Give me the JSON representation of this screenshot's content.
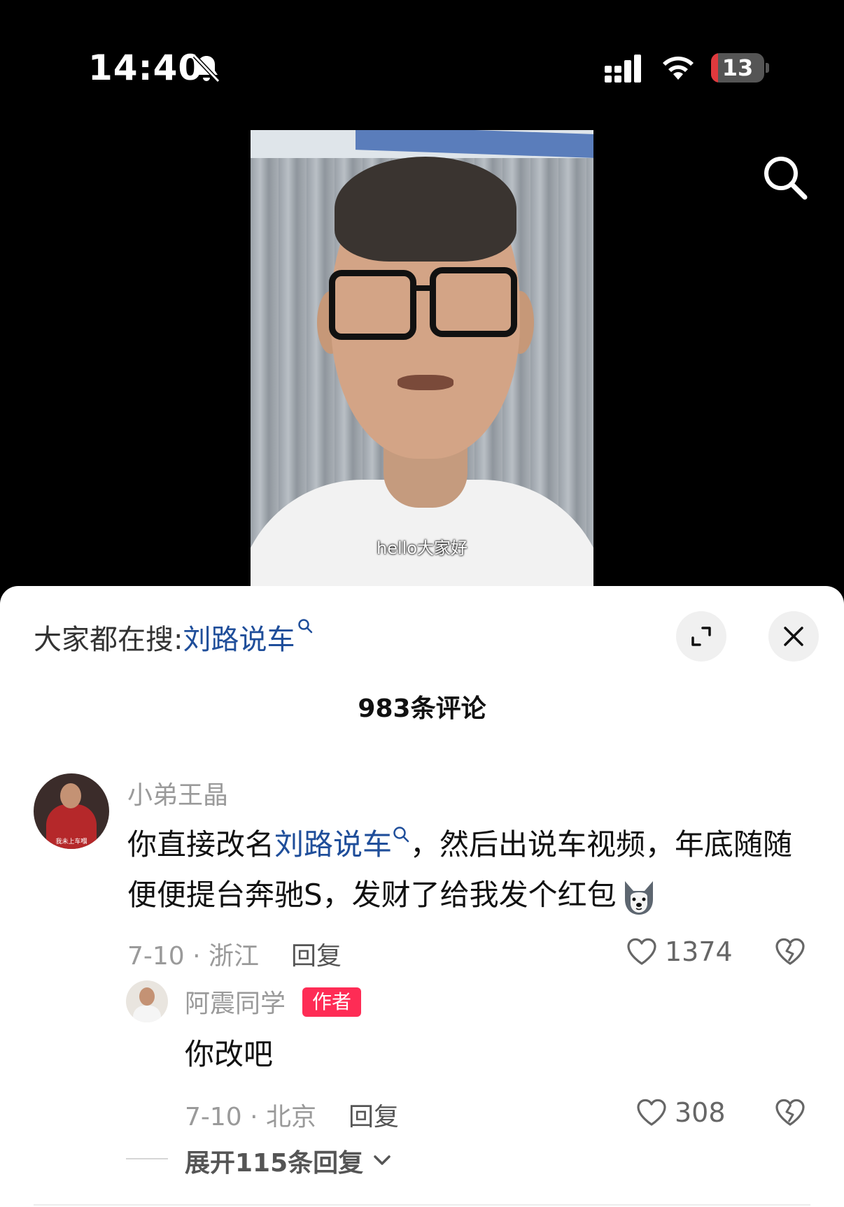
{
  "status_bar": {
    "time": "14:40",
    "battery_level": "13",
    "battery_fraction": 0.13,
    "icons": [
      "bell-muted-icon",
      "cellular-signal-icon",
      "wifi-icon",
      "battery-icon"
    ]
  },
  "video": {
    "subtitle": "hello大家好",
    "search_icon": "search-icon"
  },
  "sheet": {
    "trending_prefix": "大家都在搜:",
    "trending_keyword": "刘路说车",
    "comment_count": "983条评论"
  },
  "comment": {
    "username": "小弟王晶",
    "avatar_caption": "我未上车嗰",
    "text_before": "你直接改名",
    "keyword": "刘路说车",
    "text_after": "，然后出说车视频，年底随随便便提台奔驰S，发财了给我发个红包",
    "date_location": "7-10 · 浙江",
    "reply_label": "回复",
    "likes": "1374"
  },
  "reply": {
    "username": "阿震同学",
    "badge": "作者",
    "text": "你改吧",
    "date_location": "7-10 · 北京",
    "reply_label": "回复",
    "likes": "308"
  },
  "expand_replies": "展开115条回复",
  "colors": {
    "keyword_blue": "#1f4e9a",
    "author_badge": "#fe2c55",
    "battery_red": "#e0393d"
  }
}
